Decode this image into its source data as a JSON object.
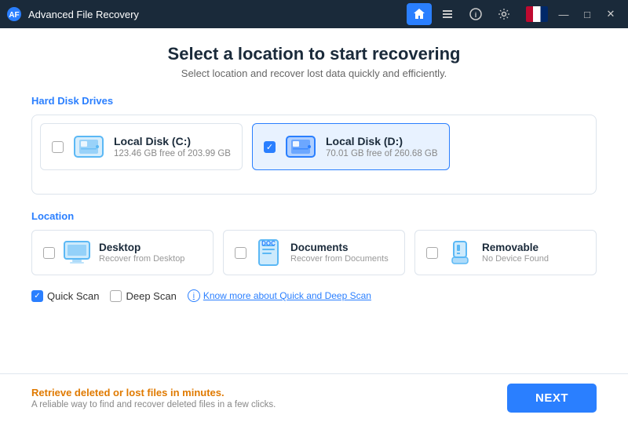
{
  "titleBar": {
    "appName": "Advanced File Recovery",
    "navIcons": [
      "home",
      "list",
      "info",
      "settings"
    ],
    "activeNav": 0,
    "controls": [
      "minimize",
      "maximize",
      "close"
    ]
  },
  "page": {
    "title": "Select a location to start recovering",
    "subtitle": "Select location and recover lost data quickly and efficiently."
  },
  "hardDiskSection": {
    "label": "Hard Disk Drives",
    "drives": [
      {
        "name": "Local Disk (C:)",
        "space": "123.46 GB free of 203.99 GB",
        "selected": false
      },
      {
        "name": "Local Disk (D:)",
        "space": "70.01 GB free of 260.68 GB",
        "selected": true
      }
    ]
  },
  "locationSection": {
    "label": "Location",
    "locations": [
      {
        "name": "Desktop",
        "sub": "Recover from Desktop",
        "selected": false
      },
      {
        "name": "Documents",
        "sub": "Recover from Documents",
        "selected": false
      },
      {
        "name": "Removable",
        "sub": "No Device Found",
        "selected": false
      }
    ]
  },
  "scanOptions": {
    "quickScan": {
      "label": "Quick Scan",
      "checked": true
    },
    "deepScan": {
      "label": "Deep Scan",
      "checked": false
    },
    "infoLink": "Know more about Quick and Deep Scan"
  },
  "footer": {
    "headline": "Retrieve deleted or lost files in minutes.",
    "sub": "A reliable way to find and recover deleted files in a few clicks.",
    "nextButton": "NEXT"
  }
}
